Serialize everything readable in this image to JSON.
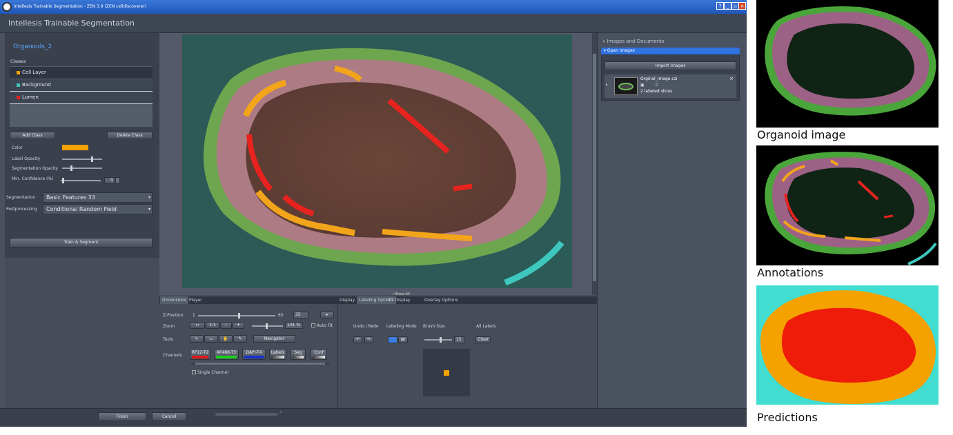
{
  "titlebar": {
    "title": "Intellesis Trainable Segmentation - ZEN 3.9 (ZEN celldiscoverer)",
    "buttons": [
      "?",
      "_",
      "▫",
      "×"
    ]
  },
  "header": {
    "title": "Intellesis Trainable Segmentation"
  },
  "left": {
    "model_name": "Organoids_2",
    "classes_label": "Classes",
    "classes": [
      {
        "name": "Cell Layer",
        "color": "#f5a100"
      },
      {
        "name": "Background",
        "color": "#3ec7bd"
      },
      {
        "name": "Lumen",
        "color": "#e8231f"
      }
    ],
    "add_class": "Add Class",
    "delete_class": "Delete Class",
    "color_label": "Color",
    "color_value": "#f5a100",
    "label_opacity": "Label Opacity",
    "seg_opacity": "Segmentation Opacity",
    "min_conf": "Min. Confidence (%)",
    "min_conf_value": "0",
    "segmentation_label": "Segmentation",
    "segmentation_value": "Basic Features 33",
    "postprocessing_label": "Postprocessing",
    "postprocessing_value": "Conditional Random Field",
    "train_segment": "Train & Segment"
  },
  "image_view": {
    "show_all": "Show All"
  },
  "bottom": {
    "tabs_left": [
      "Dimensions",
      "Player"
    ],
    "tabs_right": [
      "Display",
      "Labeling Options",
      "2D Display",
      "Overlay Options"
    ],
    "z_label": "Z-Position",
    "z_min": "1",
    "z_max": "65",
    "z_value": "35",
    "zoom_label": "Zoom",
    "zoom_fit": "1:1",
    "zoom_value": "101 %",
    "auto_fit": "Auto Fit",
    "tools_label": "Tools",
    "navigator": "Navigator",
    "channels_label": "Channels",
    "channels": [
      {
        "name": "RF12-T2",
        "color": "#e01818"
      },
      {
        "name": "AF488-T3",
        "color": "#18d018"
      },
      {
        "name": "DAPI-T4",
        "color": "#1830d0"
      },
      {
        "name": "Labels",
        "color": "#dddddd"
      },
      {
        "name": "Seg",
        "color": "#dddddd"
      },
      {
        "name": "Conf",
        "color": "#dddddd"
      }
    ],
    "single_channel": "Single Channel",
    "undo_redo": "Undo / Redo",
    "labeling_mode": "Labeling Mode",
    "brush_size": "Brush Size",
    "brush_value": "15",
    "all_labels": "All Labels",
    "clear": "Clear"
  },
  "right": {
    "section": "Images and Documents",
    "open_images": "Open Images",
    "import_images": "Import Images",
    "file_name": "Orginal_Image.czi",
    "file_flag": "C",
    "file_info": "2 labeled slices"
  },
  "footer": {
    "finish": "Finish",
    "cancel": "Cancel"
  },
  "captions": {
    "organoid": "Organoid image",
    "annotations": "Annotations",
    "predictions": "Predictions"
  }
}
